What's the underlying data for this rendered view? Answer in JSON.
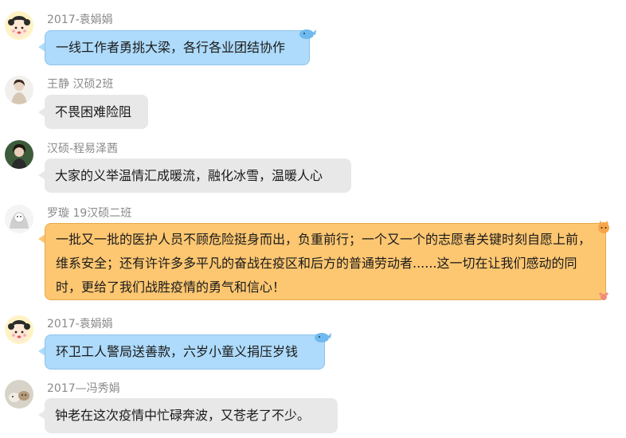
{
  "messages": [
    {
      "sender": "2017-袁娟娟",
      "text": "一线工作者勇挑大梁，各行各业团结协作",
      "style": "blue"
    },
    {
      "sender": "王静  汉硕2班",
      "text": "不畏困难险阻",
      "style": "gray"
    },
    {
      "sender": "汉硕-程易泽茜",
      "text": "大家的义举温情汇成暖流，融化冰雪，温暖人心",
      "style": "gray"
    },
    {
      "sender": "罗璇 19汉硕二班",
      "text": "一批又一批的医护人员不顾危险挺身而出，负重前行；一个又一个的志愿者关键时刻自愿上前，维系安全；还有许许多多平凡的奋战在疫区和后方的普通劳动者......这一切在让我们感动的同时，更给了我们战胜疫情的勇气和信心！",
      "style": "orange"
    },
    {
      "sender": "2017-袁娟娟",
      "text": "环卫工人警局送善款，六岁小童义捐压岁钱",
      "style": "blue"
    },
    {
      "sender": "2017—冯秀娟",
      "text": "钟老在这次疫情中忙碌奔波，又苍老了不少。",
      "style": "gray"
    }
  ],
  "colors": {
    "gray_bubble": "#e8e8e8",
    "blue_bubble": "#aedbfb",
    "orange_bubble": "#fdc772",
    "sender_text": "#8a8a8a"
  }
}
